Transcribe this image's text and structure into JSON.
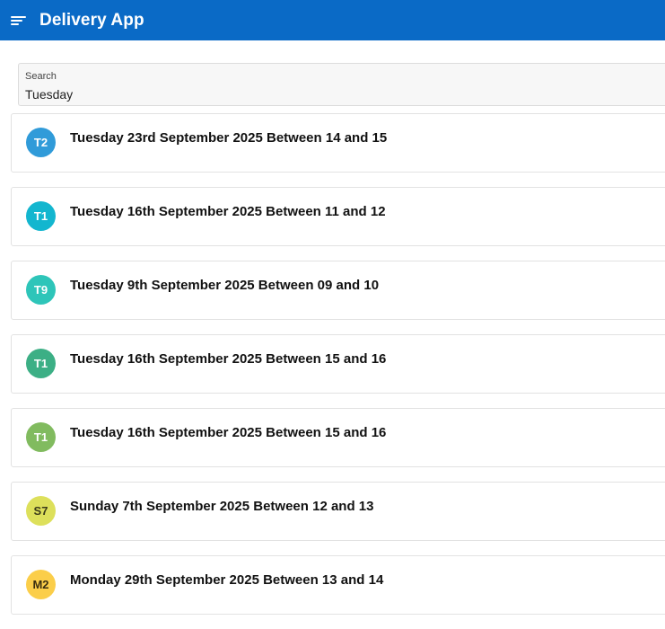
{
  "app": {
    "title": "Delivery App",
    "menu_icon": "hamburger-menu-icon",
    "header_color": "#0a6ac6"
  },
  "search": {
    "label": "Search",
    "value": "Tuesday"
  },
  "slots": [
    {
      "initials": "T2",
      "title": "Tuesday 23rd September 2025 Between 14 and 15",
      "color": "#309bd9",
      "text_color": "#ffffff"
    },
    {
      "initials": "T1",
      "title": "Tuesday 16th September 2025 Between 11 and 12",
      "color": "#13b6cf",
      "text_color": "#ffffff"
    },
    {
      "initials": "T9",
      "title": "Tuesday 9th September 2025 Between 09 and 10",
      "color": "#2ec5b9",
      "text_color": "#ffffff"
    },
    {
      "initials": "T1",
      "title": "Tuesday 16th September 2025 Between 15 and 16",
      "color": "#3caf85",
      "text_color": "#ffffff"
    },
    {
      "initials": "T1",
      "title": "Tuesday 16th September 2025 Between 15 and 16",
      "color": "#81bb5f",
      "text_color": "#ffffff"
    },
    {
      "initials": "S7",
      "title": "Sunday 7th September 2025 Between 12 and 13",
      "color": "#dde05b",
      "text_color": "#3a3a1a"
    },
    {
      "initials": "M2",
      "title": "Monday 29th September 2025 Between 13 and 14",
      "color": "#fbce4a",
      "text_color": "#3a2e10"
    }
  ]
}
